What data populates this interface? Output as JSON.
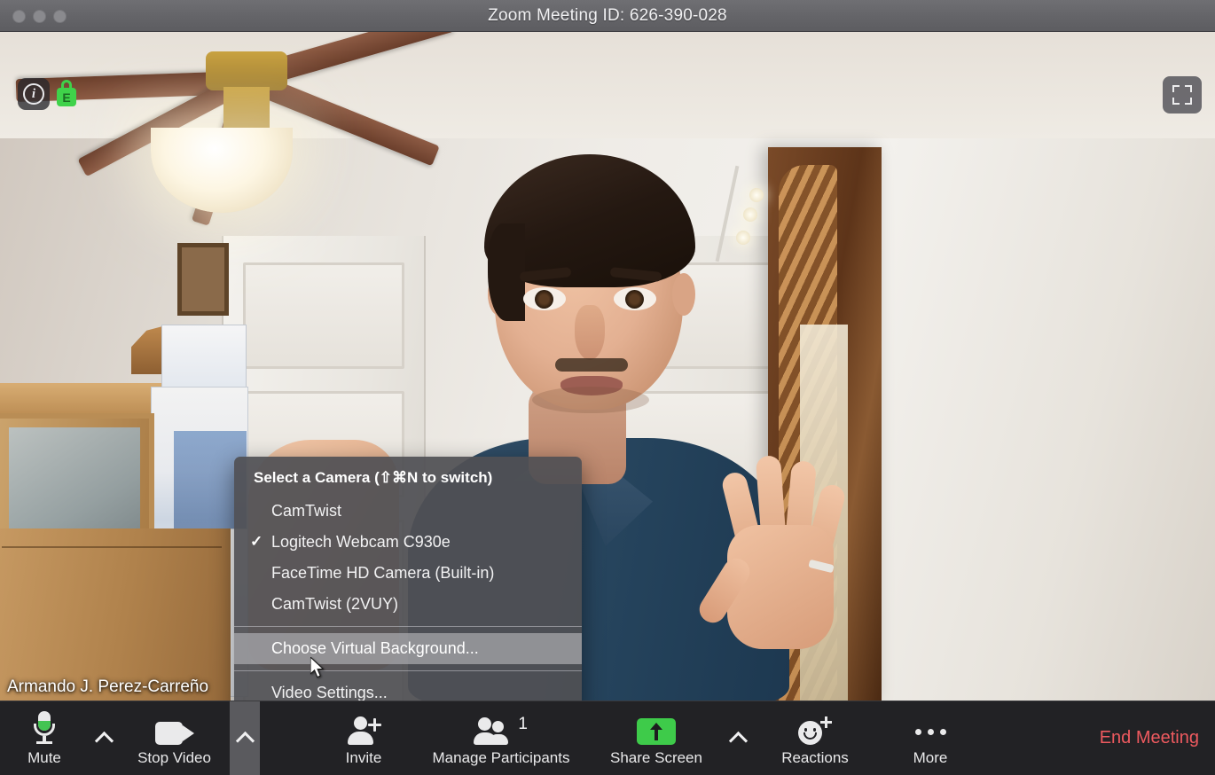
{
  "window": {
    "title": "Zoom Meeting ID: 626-390-028",
    "traffic_lights": [
      "close",
      "minimize",
      "zoom"
    ]
  },
  "video_overlay": {
    "info_icon": "info-icon",
    "info_glyph": "i",
    "encryption_icon": "encryption-lock-icon",
    "encryption_glyph": "E",
    "fullscreen_icon": "fullscreen-icon",
    "participant_name": "Armando J. Perez-Carreño"
  },
  "camera_menu": {
    "header": "Select a Camera (⇧⌘N to switch)",
    "checkmark": "✓",
    "cameras": [
      {
        "label": "CamTwist",
        "selected": false
      },
      {
        "label": "Logitech Webcam C930e",
        "selected": true
      },
      {
        "label": "FaceTime HD Camera (Built-in)",
        "selected": false
      },
      {
        "label": "CamTwist (2VUY)",
        "selected": false
      }
    ],
    "virtual_background": "Choose Virtual Background...",
    "video_settings": "Video Settings..."
  },
  "toolbar": {
    "mute_label": "Mute",
    "stop_video_label": "Stop Video",
    "invite_label": "Invite",
    "manage_participants_label": "Manage Participants",
    "participants_count": "1",
    "share_screen_label": "Share Screen",
    "reactions_label": "Reactions",
    "more_label": "More",
    "end_meeting_label": "End Meeting"
  },
  "colors": {
    "titlebar": "#646468",
    "toolbar_bg": "#222225",
    "share_green": "#3ecb4a",
    "mic_level_green": "#44c452",
    "encryption_green": "#3fd24a",
    "end_meeting_red": "#ee5a5f",
    "menu_bg": "#505054",
    "menu_highlight": "#aaaaae",
    "active_chevron_bg": "#5a5a5e"
  }
}
